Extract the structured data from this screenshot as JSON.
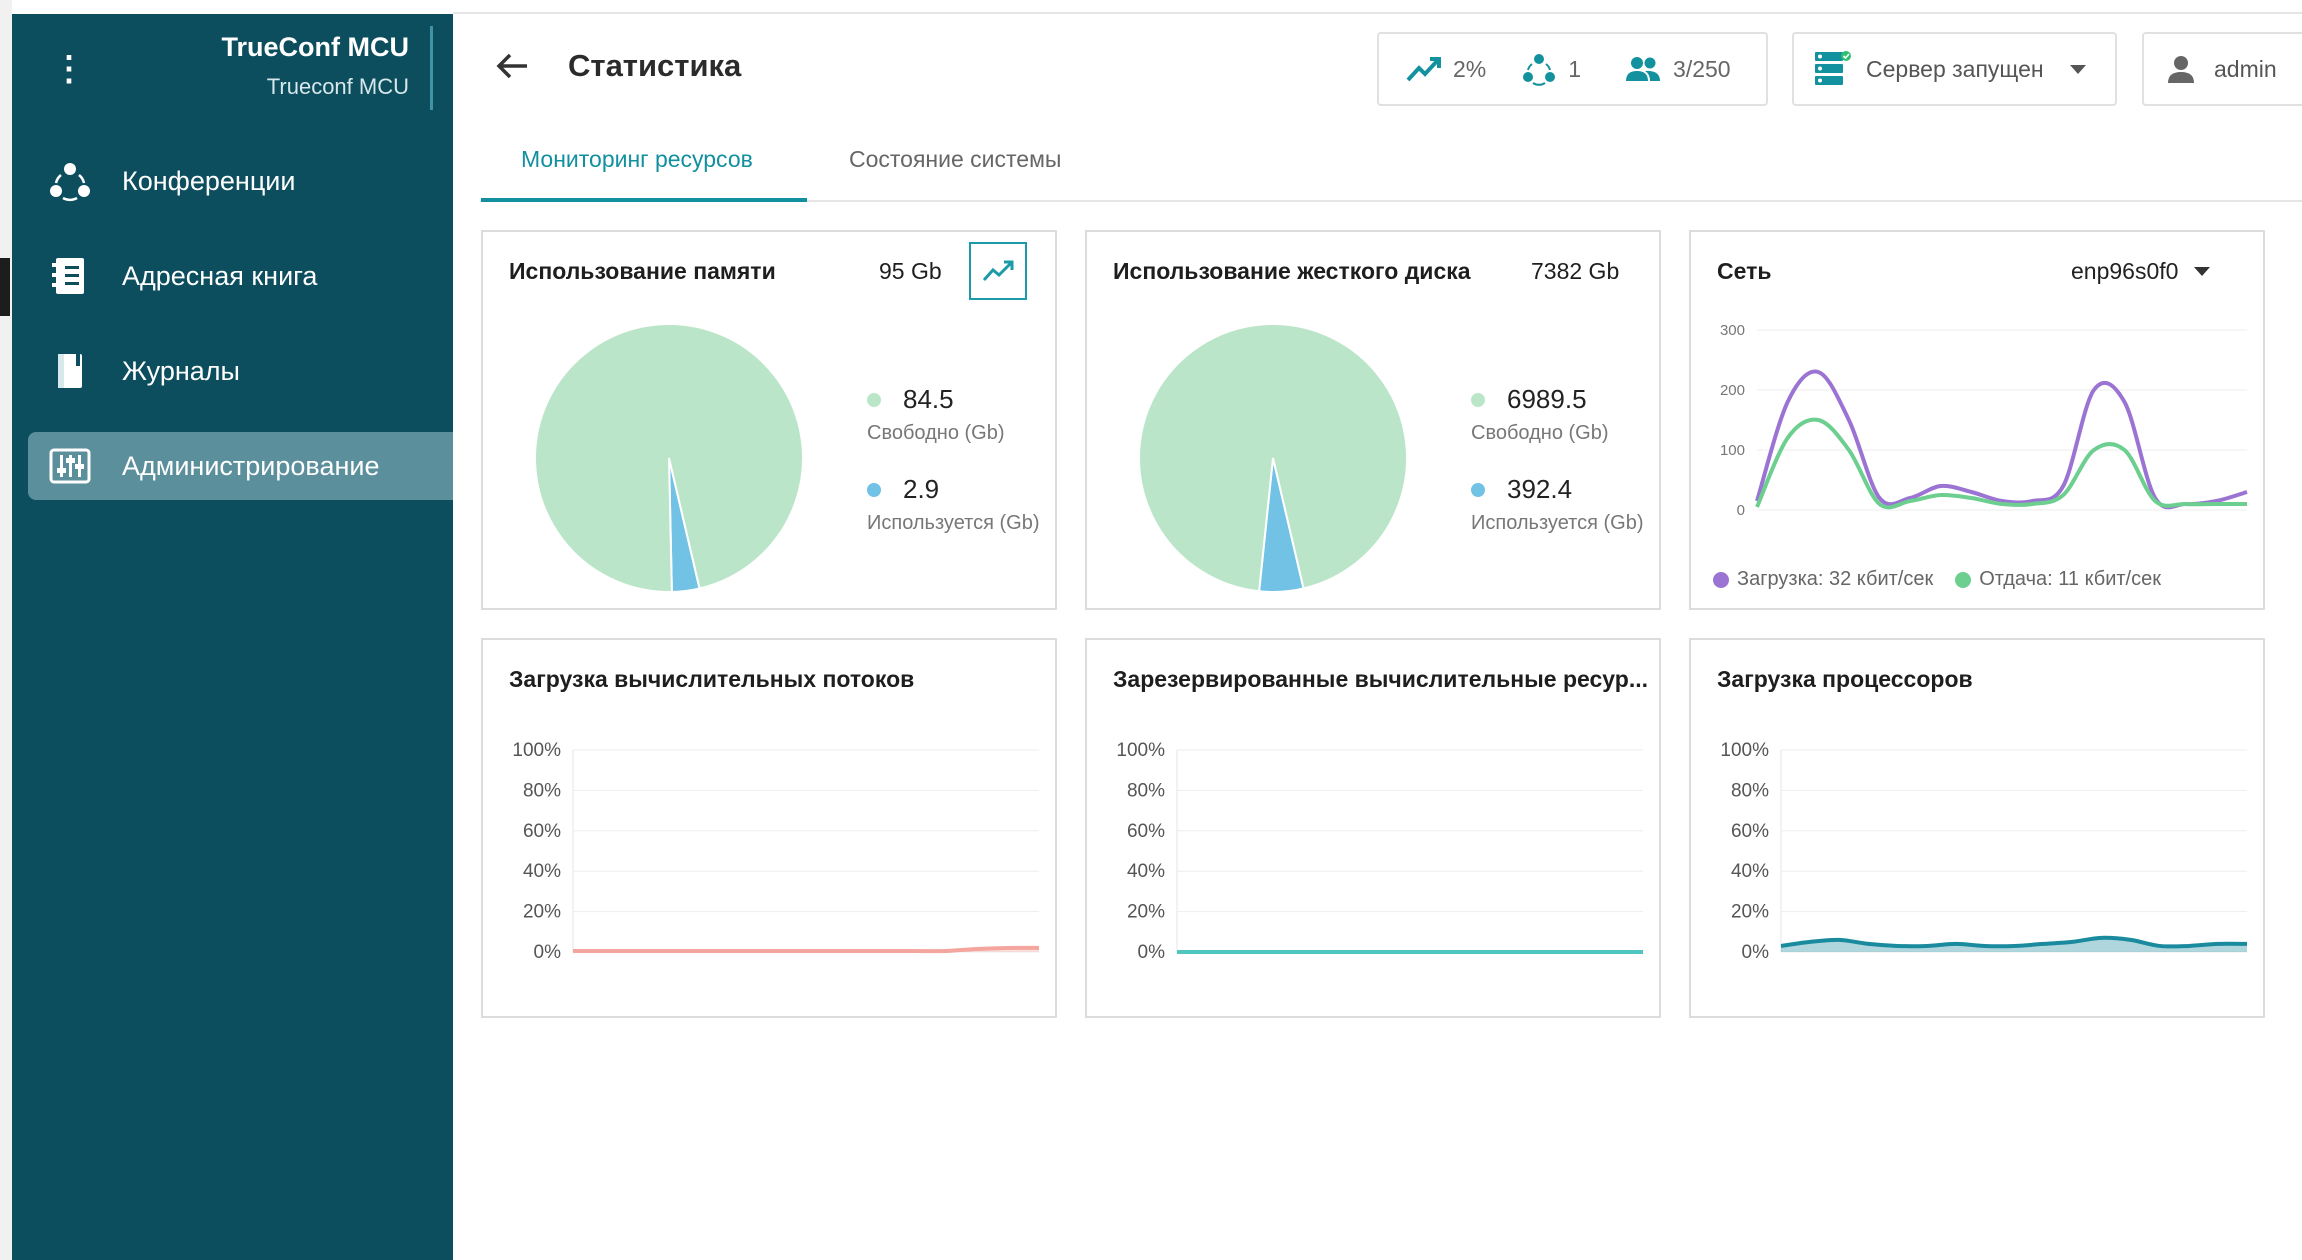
{
  "app": {
    "title": "TrueConf MCU",
    "subtitle": "Trueconf MCU",
    "menu_icon": "kebab-vertical-icon"
  },
  "sidebar": {
    "items": [
      {
        "label": "Конференции",
        "icon": "conference-icon",
        "active": false
      },
      {
        "label": "Адресная книга",
        "icon": "address-book-icon",
        "active": false
      },
      {
        "label": "Журналы",
        "icon": "book-icon",
        "active": false
      },
      {
        "label": "Администрирование",
        "icon": "sliders-icon",
        "active": true
      }
    ]
  },
  "header": {
    "title": "Статистика",
    "back_icon": "arrow-left-icon",
    "stats": {
      "load": "2%",
      "conferences": "1",
      "participants": "3/250"
    },
    "server_status": "Сервер запущен",
    "user": "admin"
  },
  "tabs": [
    {
      "label": "Мониторинг ресурсов",
      "active": true
    },
    {
      "label": "Состояние системы",
      "active": false
    }
  ],
  "colors": {
    "sidebar_bg": "#0c4e5e",
    "accent": "#12909f",
    "free": "#bbe5c8",
    "used": "#72c2e6",
    "download": "#9b74d3",
    "upload": "#6ccf8f",
    "threads": "#f3a59e",
    "reserved": "#4fc7c0",
    "cpu": "#1a8a9e"
  },
  "memory": {
    "title": "Использование памяти",
    "total": "95 Gb",
    "free_value": "84.5",
    "free_label": "Свободно (Gb)",
    "used_value": "2.9",
    "used_label": "Используется (Gb)"
  },
  "disk": {
    "title": "Использование жесткого диска",
    "total": "7382 Gb",
    "free_value": "6989.5",
    "free_label": "Свободно (Gb)",
    "used_value": "392.4",
    "used_label": "Используется (Gb)"
  },
  "network": {
    "title": "Сеть",
    "interface": "enp96s0f0",
    "download_label": "Загрузка: 32 кбит/сек",
    "upload_label": "Отдача: 11 кбит/сек"
  },
  "threads": {
    "title": "Загрузка вычислительных потоков"
  },
  "reserved": {
    "title": "Зарезервированные вычислительные ресур..."
  },
  "cpu": {
    "title": "Загрузка процессоров"
  },
  "chart_data": [
    {
      "type": "pie",
      "title": "Использование памяти",
      "labels": [
        "Свободно (Gb)",
        "Используется (Gb)"
      ],
      "values": [
        84.5,
        2.9
      ]
    },
    {
      "type": "pie",
      "title": "Использование жесткого диска",
      "labels": [
        "Свободно (Gb)",
        "Используется (Gb)"
      ],
      "values": [
        6989.5,
        392.4
      ]
    },
    {
      "type": "line",
      "title": "Сеть",
      "ylim": [
        0,
        300
      ],
      "yticks": [
        "0",
        "100",
        "200",
        "300"
      ],
      "series": [
        {
          "name": "Загрузка: 32 кбит/сек",
          "values": [
            15,
            180,
            230,
            150,
            20,
            20,
            40,
            30,
            15,
            15,
            40,
            200,
            180,
            20,
            10,
            15,
            30
          ]
        },
        {
          "name": "Отдача: 11 кбит/сек",
          "values": [
            5,
            120,
            150,
            100,
            10,
            15,
            25,
            20,
            10,
            10,
            25,
            100,
            100,
            15,
            10,
            10,
            10
          ]
        }
      ]
    },
    {
      "type": "area",
      "title": "Загрузка вычислительных потоков",
      "ylim": [
        0,
        100
      ],
      "yticks": [
        "0%",
        "20%",
        "40%",
        "60%",
        "80%",
        "100%"
      ],
      "values": [
        0.5,
        0.5,
        0.5,
        0.5,
        0.5,
        0.5,
        0.5,
        0.5,
        0.5,
        0.5,
        0.5,
        0.5,
        0.5,
        1.5,
        2,
        2
      ]
    },
    {
      "type": "area",
      "title": "Зарезервированные вычислительные ресур...",
      "ylim": [
        0,
        100
      ],
      "yticks": [
        "0%",
        "20%",
        "40%",
        "60%",
        "80%",
        "100%"
      ],
      "values": [
        0,
        0,
        0,
        0,
        0,
        0,
        0,
        0,
        0,
        0,
        0,
        0,
        0,
        0,
        0,
        0
      ]
    },
    {
      "type": "area",
      "title": "Загрузка процессоров",
      "ylim": [
        0,
        100
      ],
      "yticks": [
        "0%",
        "20%",
        "40%",
        "60%",
        "80%",
        "100%"
      ],
      "values": [
        3,
        5,
        6,
        4,
        3,
        3,
        4,
        3,
        3,
        4,
        5,
        7,
        6,
        3,
        3,
        4,
        4
      ]
    }
  ]
}
